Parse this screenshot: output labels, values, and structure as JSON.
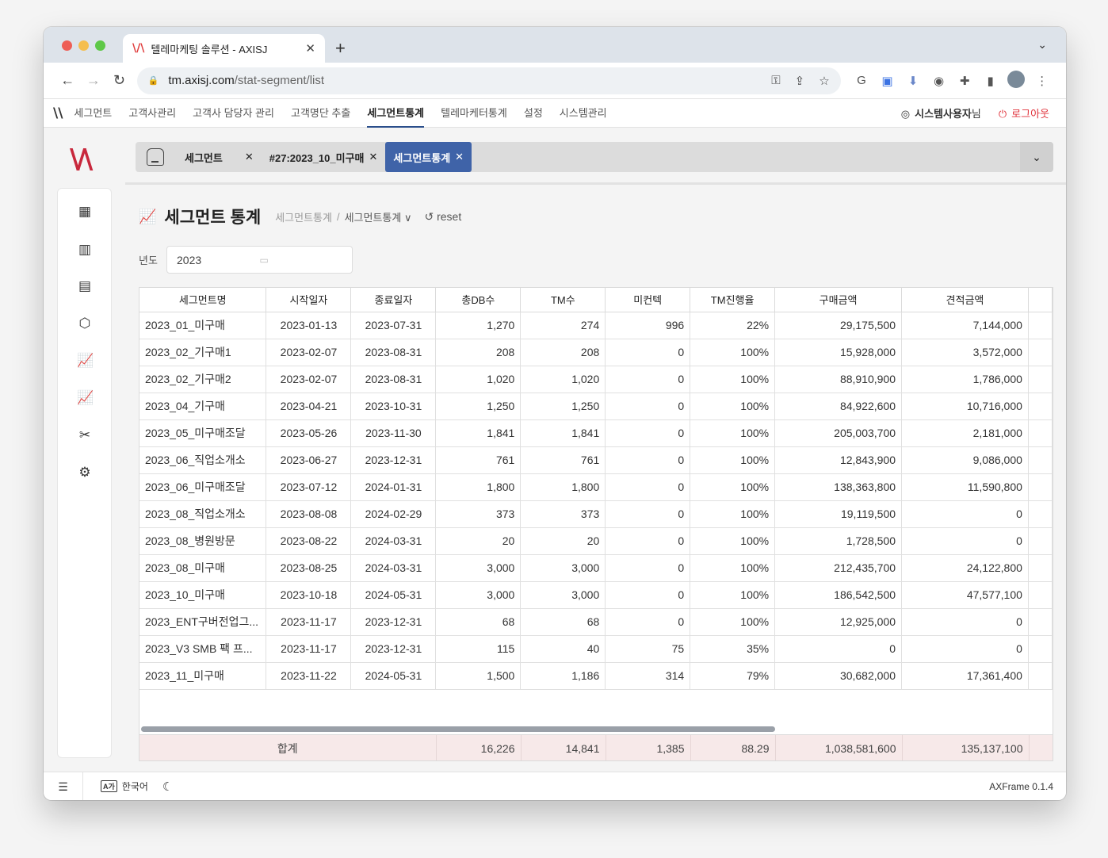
{
  "browser": {
    "tab_title": "텔레마케팅 솔루션 - AXISJ",
    "url_host": "tm.axisj.com",
    "url_path": "/stat-segment/list"
  },
  "menu": {
    "items": [
      "세그먼트",
      "고객사관리",
      "고객사 담당자 관리",
      "고객명단 추출",
      "세그먼트통계",
      "텔레마케터통계",
      "설정",
      "시스템관리"
    ],
    "active": "세그먼트통계",
    "user": "시스템사용자",
    "user_suffix": "님",
    "logout": "로그아웃"
  },
  "page_tabs": [
    {
      "label": "세그먼트",
      "active": false
    },
    {
      "label": "#27:2023_10_미구매",
      "active": false
    },
    {
      "label": "세그먼트통계",
      "active": true
    }
  ],
  "page": {
    "title": "세그먼트 통계",
    "breadcrumb_1": "세그먼트통계",
    "breadcrumb_2": "세그먼트통계",
    "reset": "reset"
  },
  "filter": {
    "year_label": "년도",
    "year_value": "2023"
  },
  "table": {
    "columns": [
      "세그먼트명",
      "시작일자",
      "종료일자",
      "총DB수",
      "TM수",
      "미컨텍",
      "TM진행율",
      "구매금액",
      "견적금액"
    ],
    "rows": [
      [
        "2023_01_미구매",
        "2023-01-13",
        "2023-07-31",
        "1,270",
        "274",
        "996",
        "22%",
        "29,175,500",
        "7,144,000"
      ],
      [
        "2023_02_기구매1",
        "2023-02-07",
        "2023-08-31",
        "208",
        "208",
        "0",
        "100%",
        "15,928,000",
        "3,572,000"
      ],
      [
        "2023_02_기구매2",
        "2023-02-07",
        "2023-08-31",
        "1,020",
        "1,020",
        "0",
        "100%",
        "88,910,900",
        "1,786,000"
      ],
      [
        "2023_04_기구매",
        "2023-04-21",
        "2023-10-31",
        "1,250",
        "1,250",
        "0",
        "100%",
        "84,922,600",
        "10,716,000"
      ],
      [
        "2023_05_미구매조달",
        "2023-05-26",
        "2023-11-30",
        "1,841",
        "1,841",
        "0",
        "100%",
        "205,003,700",
        "2,181,000"
      ],
      [
        "2023_06_직업소개소",
        "2023-06-27",
        "2023-12-31",
        "761",
        "761",
        "0",
        "100%",
        "12,843,900",
        "9,086,000"
      ],
      [
        "2023_06_미구매조달",
        "2023-07-12",
        "2024-01-31",
        "1,800",
        "1,800",
        "0",
        "100%",
        "138,363,800",
        "11,590,800"
      ],
      [
        "2023_08_직업소개소",
        "2023-08-08",
        "2024-02-29",
        "373",
        "373",
        "0",
        "100%",
        "19,119,500",
        "0"
      ],
      [
        "2023_08_병원방문",
        "2023-08-22",
        "2024-03-31",
        "20",
        "20",
        "0",
        "100%",
        "1,728,500",
        "0"
      ],
      [
        "2023_08_미구매",
        "2023-08-25",
        "2024-03-31",
        "3,000",
        "3,000",
        "0",
        "100%",
        "212,435,700",
        "24,122,800"
      ],
      [
        "2023_10_미구매",
        "2023-10-18",
        "2024-05-31",
        "3,000",
        "3,000",
        "0",
        "100%",
        "186,542,500",
        "47,577,100"
      ],
      [
        "2023_ENT구버전업그...",
        "2023-11-17",
        "2023-12-31",
        "68",
        "68",
        "0",
        "100%",
        "12,925,000",
        "0"
      ],
      [
        "2023_V3 SMB 팩 프...",
        "2023-11-17",
        "2023-12-31",
        "115",
        "40",
        "75",
        "35%",
        "0",
        "0"
      ],
      [
        "2023_11_미구매",
        "2023-11-22",
        "2024-05-31",
        "1,500",
        "1,186",
        "314",
        "79%",
        "30,682,000",
        "17,361,400"
      ]
    ],
    "footer": [
      "합계",
      "16,226",
      "14,841",
      "1,385",
      "88.29",
      "1,038,581,600",
      "135,137,100"
    ]
  },
  "status": {
    "language": "한국어",
    "version": "AXFrame 0.1.4"
  },
  "colors": {
    "brand": "#c8283c",
    "active_tab": "#3f63a8",
    "footer_bg": "#f7e9e9",
    "logout": "#e0313a"
  },
  "icons": [
    "back-arrow-icon",
    "forward-arrow-icon",
    "reload-icon",
    "lock-icon",
    "key-icon",
    "share-icon",
    "star-icon",
    "home-icon",
    "calendar-icon",
    "chart-icon",
    "reset-icon"
  ]
}
